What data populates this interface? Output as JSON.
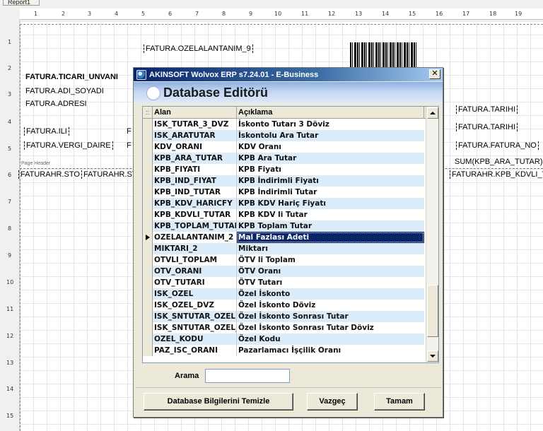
{
  "designer": {
    "tab_label": "Report1",
    "ruler_h": [
      "1",
      "2",
      "3",
      "4",
      "5",
      "6",
      "7",
      "8",
      "9",
      "10",
      "11",
      "12",
      "13",
      "14",
      "15",
      "16",
      "17",
      "18",
      "19"
    ],
    "ruler_v": [
      "1",
      "2",
      "3",
      "4",
      "5",
      "6",
      "7",
      "8",
      "9",
      "10",
      "11",
      "12",
      "13",
      "14",
      "15"
    ],
    "band_label": "Page Header",
    "fields": {
      "ozel": "FATURA.OZELALANTANIM_9",
      "ticari": "FATURA.TICARI_UNVANI",
      "adi": "FATURA.ADI_SOYADI",
      "adres": "FATURA.ADRESI",
      "ili": "FATURA.ILI",
      "vergi": "FATURA.VERGI_DAIRE",
      "tarihi1": "FATURA.TARIHI",
      "tarihi2": "FATURA.TARIHI",
      "fatura_no": "FATURA.FATURA_NO",
      "sum": "SUM(KPB_ARA_TUTAR)",
      "sto": "FATURAHR.STO",
      "st": "FATURAHR.ST",
      "kdvli": "FATURAHR.KPB_KDVLI_T",
      "f1": "F",
      "f2": "F"
    }
  },
  "dialog": {
    "title": "AKINSOFT Wolvox ERP s7.24.01 - E-Business",
    "close_glyph": "✕",
    "heading": "Database Editörü",
    "columns": {
      "ind": "::",
      "alan": "Alan",
      "aciklama": "Açıklama"
    },
    "rows": [
      {
        "alan": "ISK_TUTAR_3_DVZ",
        "aciklama": "İskonto Tutarı 3 Döviz"
      },
      {
        "alan": "ISK_ARATUTAR",
        "aciklama": "İskontolu Ara Tutar"
      },
      {
        "alan": "KDV_ORANI",
        "aciklama": "KDV Oranı"
      },
      {
        "alan": "KPB_ARA_TUTAR",
        "aciklama": "KPB Ara Tutar"
      },
      {
        "alan": "KPB_FIYATI",
        "aciklama": "KPB Fiyatı"
      },
      {
        "alan": "KPB_IND_FIYAT",
        "aciklama": "KPB İndirimli Fiyatı"
      },
      {
        "alan": "KPB_IND_TUTAR",
        "aciklama": "KPB İndirimli Tutar"
      },
      {
        "alan": "KPB_KDV_HARICFY",
        "aciklama": "KPB KDV Hariç Fiyatı"
      },
      {
        "alan": "KPB_KDVLI_TUTAR",
        "aciklama": "KPB KDV li Tutar"
      },
      {
        "alan": "KPB_TOPLAM_TUTAR",
        "aciklama": "KPB Toplam Tutar"
      },
      {
        "alan": "OZELALANTANIM_2",
        "aciklama": "Mal Fazlası Adeti"
      },
      {
        "alan": "MIKTARI_2",
        "aciklama": "Miktarı"
      },
      {
        "alan": "OTVLI_TOPLAM",
        "aciklama": "ÖTV li Toplam"
      },
      {
        "alan": "OTV_ORANI",
        "aciklama": "ÖTV Oranı"
      },
      {
        "alan": "OTV_TUTARI",
        "aciklama": "ÖTV Tutarı"
      },
      {
        "alan": "ISK_OZEL",
        "aciklama": "Özel İskonto"
      },
      {
        "alan": "ISK_OZEL_DVZ",
        "aciklama": "Özel İskonto Döviz"
      },
      {
        "alan": "ISK_SNTUTAR_OZEL",
        "aciklama": "Özel İskonto Sonrası Tutar"
      },
      {
        "alan": "ISK_SNTUTAR_OZEL_",
        "aciklama": "Özel İskonto Sonrası Tutar Döviz"
      },
      {
        "alan": "OZEL_KODU",
        "aciklama": "Özel Kodu"
      },
      {
        "alan": "PAZ_ISC_ORANI",
        "aciklama": "Pazarlamacı İşçilik Oranı"
      }
    ],
    "selected_row": 10,
    "search": {
      "label": "Arama",
      "value": ""
    },
    "buttons": {
      "clear": "Database Bilgilerini Temizle",
      "cancel": "Vazgeç",
      "ok": "Tamam"
    },
    "colors": {
      "title_start": "#0a246a",
      "selection": "#0a246a",
      "alt_row": "#dcebf8"
    }
  }
}
